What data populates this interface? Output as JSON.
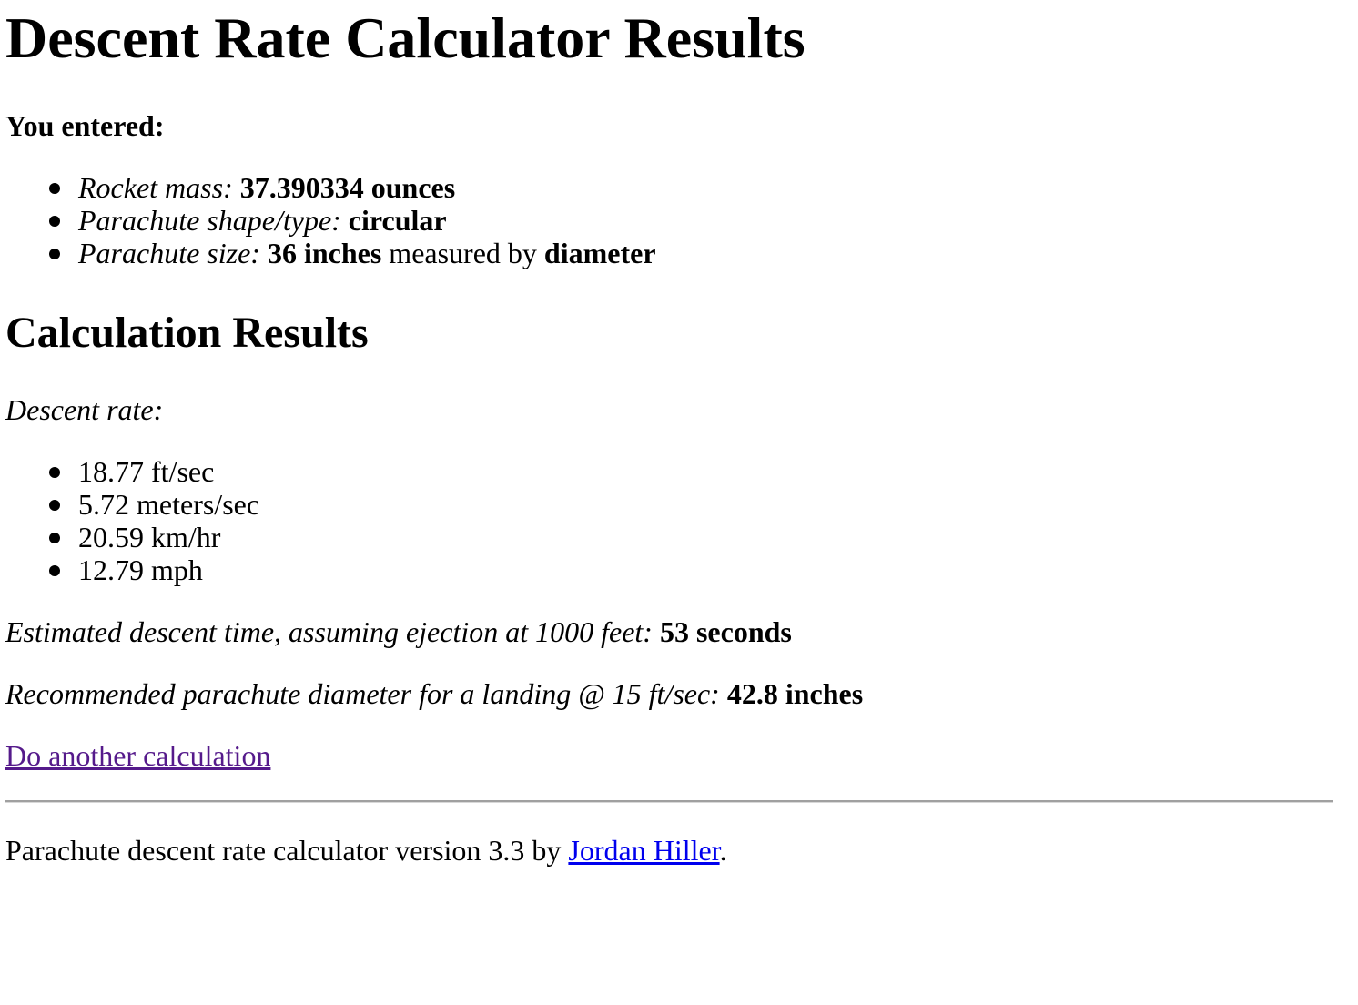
{
  "title": "Descent Rate Calculator Results",
  "entered": {
    "heading": "You entered:",
    "items": [
      {
        "label": "Rocket mass:",
        "value": "37.390334 ounces"
      },
      {
        "label": "Parachute shape/type:",
        "value": "circular"
      },
      {
        "label": "Parachute size:",
        "value": "36 inches",
        "middle": "measured by",
        "value2": "diameter"
      }
    ]
  },
  "results": {
    "heading": "Calculation Results",
    "descent_rate_label": "Descent rate:",
    "descent_rates": [
      "18.77 ft/sec",
      "5.72 meters/sec",
      "20.59 km/hr",
      "12.79 mph"
    ],
    "descent_time_label": "Estimated descent time, assuming ejection at 1000 feet:",
    "descent_time_value": "53 seconds",
    "recommended_label": "Recommended parachute diameter for a landing @ 15 ft/sec:",
    "recommended_value": "42.8 inches"
  },
  "links": {
    "another": "Do another calculation"
  },
  "footer": {
    "text_before": "Parachute descent rate calculator version 3.3 by",
    "author": "Jordan Hiller",
    "text_after": "."
  },
  "colors": {
    "visited_link": "#551a8b",
    "link": "#0000ee",
    "rule": "#a0a0a0"
  }
}
